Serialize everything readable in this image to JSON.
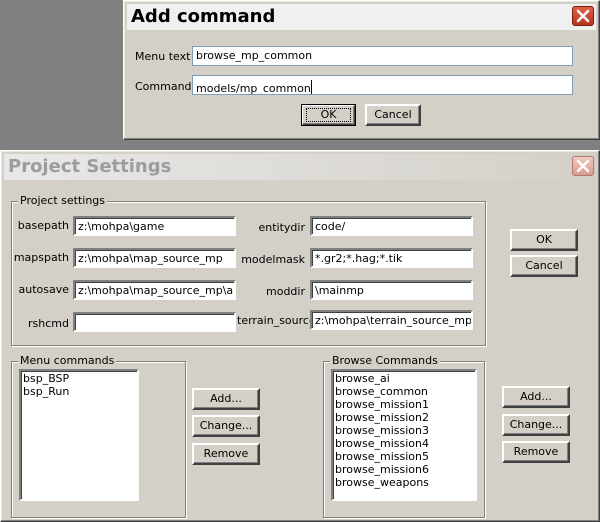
{
  "add_command": {
    "title": "Add command",
    "menu_text_label": "Menu text",
    "menu_text_value": "browse_mp_common",
    "command_label": "Command",
    "command_value": "models/mp_common",
    "ok_label": "OK",
    "cancel_label": "Cancel"
  },
  "project_settings": {
    "title": "Project Settings",
    "group_title": "Project settings",
    "fields": {
      "basepath": {
        "label": "basepath",
        "value": "z:\\mohpa\\game"
      },
      "mapspath": {
        "label": "mapspath",
        "value": "z:\\mohpa\\map_source_mp"
      },
      "autosave": {
        "label": "autosave",
        "value": "z:\\mohpa\\map_source_mp\\auto"
      },
      "rshcmd": {
        "label": "rshcmd",
        "value": ""
      },
      "entitydir": {
        "label": "entitydir",
        "value": "code/"
      },
      "modelmask": {
        "label": "modelmask",
        "value": "*.gr2;*.hag;*.tik"
      },
      "moddir": {
        "label": "moddir",
        "value": "\\mainmp"
      },
      "terrain_source": {
        "label": "terrain_source",
        "value": "z:\\mohpa\\terrain_source_mp"
      }
    },
    "ok_label": "OK",
    "cancel_label": "Cancel",
    "menu_commands": {
      "title": "Menu commands",
      "items": [
        "bsp_BSP",
        "bsp_Run"
      ],
      "add_label": "Add...",
      "change_label": "Change...",
      "remove_label": "Remove"
    },
    "browse_commands": {
      "title": "Browse Commands",
      "items": [
        "browse_ai",
        "browse_common",
        "browse_mission1",
        "browse_mission2",
        "browse_mission3",
        "browse_mission4",
        "browse_mission5",
        "browse_mission6",
        "browse_weapons"
      ],
      "add_label": "Add...",
      "change_label": "Change...",
      "remove_label": "Remove"
    }
  }
}
